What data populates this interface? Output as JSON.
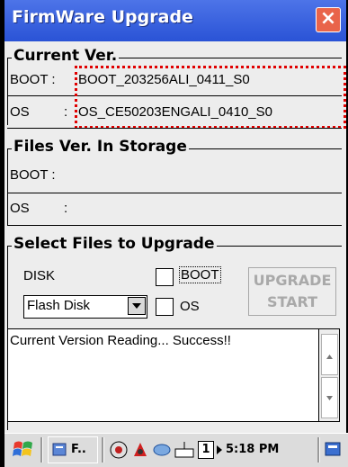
{
  "window": {
    "title": "FirmWare Upgrade",
    "close_label": "×"
  },
  "current_ver": {
    "title": "Current Ver.",
    "boot_label": "BOOT :",
    "boot_value": "BOOT_203256ALI_0411_S0",
    "os_label": "OS",
    "os_colon": ":",
    "os_value": "OS_CE50203ENGALI_0410_S0"
  },
  "storage": {
    "title": "Files Ver. In Storage",
    "boot_label": "BOOT :",
    "os_label": "OS",
    "os_colon": ":"
  },
  "select": {
    "title": "Select Files to Upgrade",
    "disk_label": "DISK",
    "disk_value": "Flash Disk",
    "boot_checkbox_label": "BOOT",
    "os_checkbox_label": "OS",
    "button_label_1": "UPGRADE",
    "button_label_2": "START"
  },
  "log": {
    "message": "Current Version Reading... Success!!"
  },
  "taskbar": {
    "app_label": "F..",
    "input_indicator": "1",
    "time": "5:18 PM"
  },
  "colors": {
    "titlebar": "#2a53d6",
    "highlight": "#e00000",
    "disabled_text": "#a9a9a9"
  }
}
